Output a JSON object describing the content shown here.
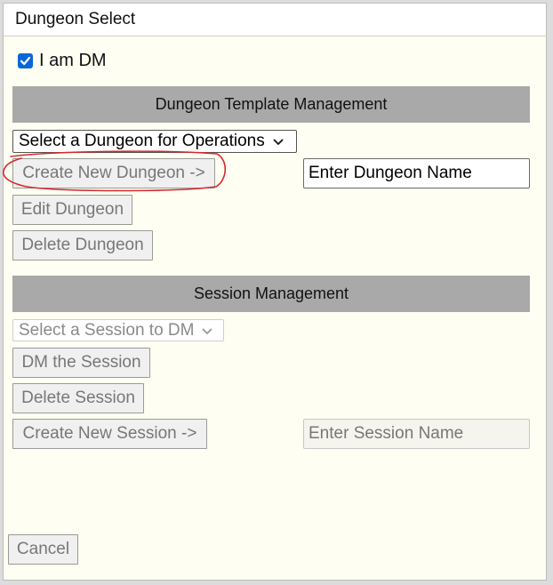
{
  "window": {
    "title": "Dungeon Select"
  },
  "dm_toggle": {
    "label": "I am DM",
    "checked": true
  },
  "dungeon_section": {
    "header": "Dungeon Template Management",
    "select_value": "Select a Dungeon for Operations",
    "create_button": "Create New Dungeon ->",
    "name_field": {
      "value": "Enter Dungeon Name"
    },
    "edit_button": "Edit Dungeon",
    "delete_button": "Delete Dungeon"
  },
  "session_section": {
    "header": "Session Management",
    "select_value": "Select a Session to DM",
    "dm_button": "DM the Session",
    "delete_button": "Delete Session",
    "create_button": "Create New Session ->",
    "name_field": {
      "value": "Enter Session Name"
    }
  },
  "footer": {
    "cancel_button": "Cancel"
  },
  "colors": {
    "accent": "#0a66d8",
    "header_bg": "#a9a9a9",
    "panel_bg": "#fefef2",
    "annotation": "#d9262c"
  },
  "icons": {
    "checkbox": "checkmark-icon",
    "dropdown": "chevron-down-icon"
  }
}
